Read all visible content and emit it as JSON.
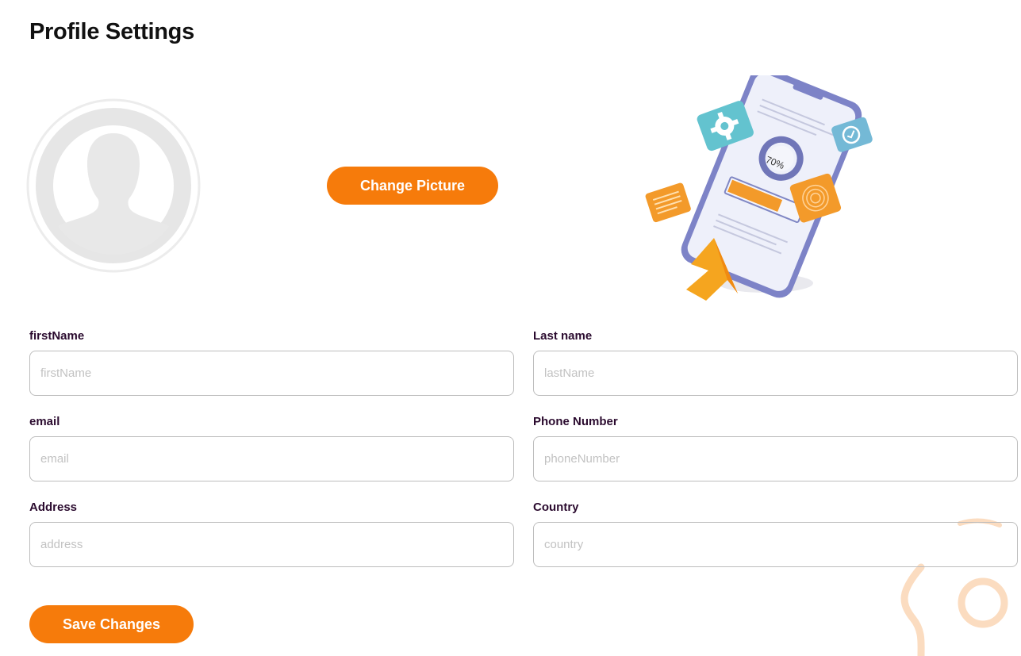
{
  "page": {
    "title": "Profile Settings"
  },
  "avatar": {
    "icon": "user-silhouette-icon"
  },
  "buttons": {
    "change_picture": "Change Picture",
    "save_changes": "Save Changes"
  },
  "illustration": {
    "progress_label": "70%",
    "icons": [
      "gear-icon",
      "clock-icon",
      "document-icon",
      "fingerprint-icon",
      "cursor-arrow-icon"
    ]
  },
  "form": {
    "first_name": {
      "label": "firstName",
      "placeholder": "firstName",
      "value": ""
    },
    "last_name": {
      "label": "Last name",
      "placeholder": "lastName",
      "value": ""
    },
    "email": {
      "label": "email",
      "placeholder": "email",
      "value": ""
    },
    "phone": {
      "label": "Phone Number",
      "placeholder": "phoneNumber",
      "value": ""
    },
    "address": {
      "label": "Address",
      "placeholder": "address",
      "value": ""
    },
    "country": {
      "label": "Country",
      "placeholder": "country",
      "value": ""
    }
  },
  "colors": {
    "accent": "#f67b0b",
    "label": "#2a0a2e",
    "input_border": "#bdbdbd",
    "placeholder": "#c2c2c2",
    "avatar_gray": "#e8e8e8",
    "deco_peach": "#fbdcc0"
  }
}
